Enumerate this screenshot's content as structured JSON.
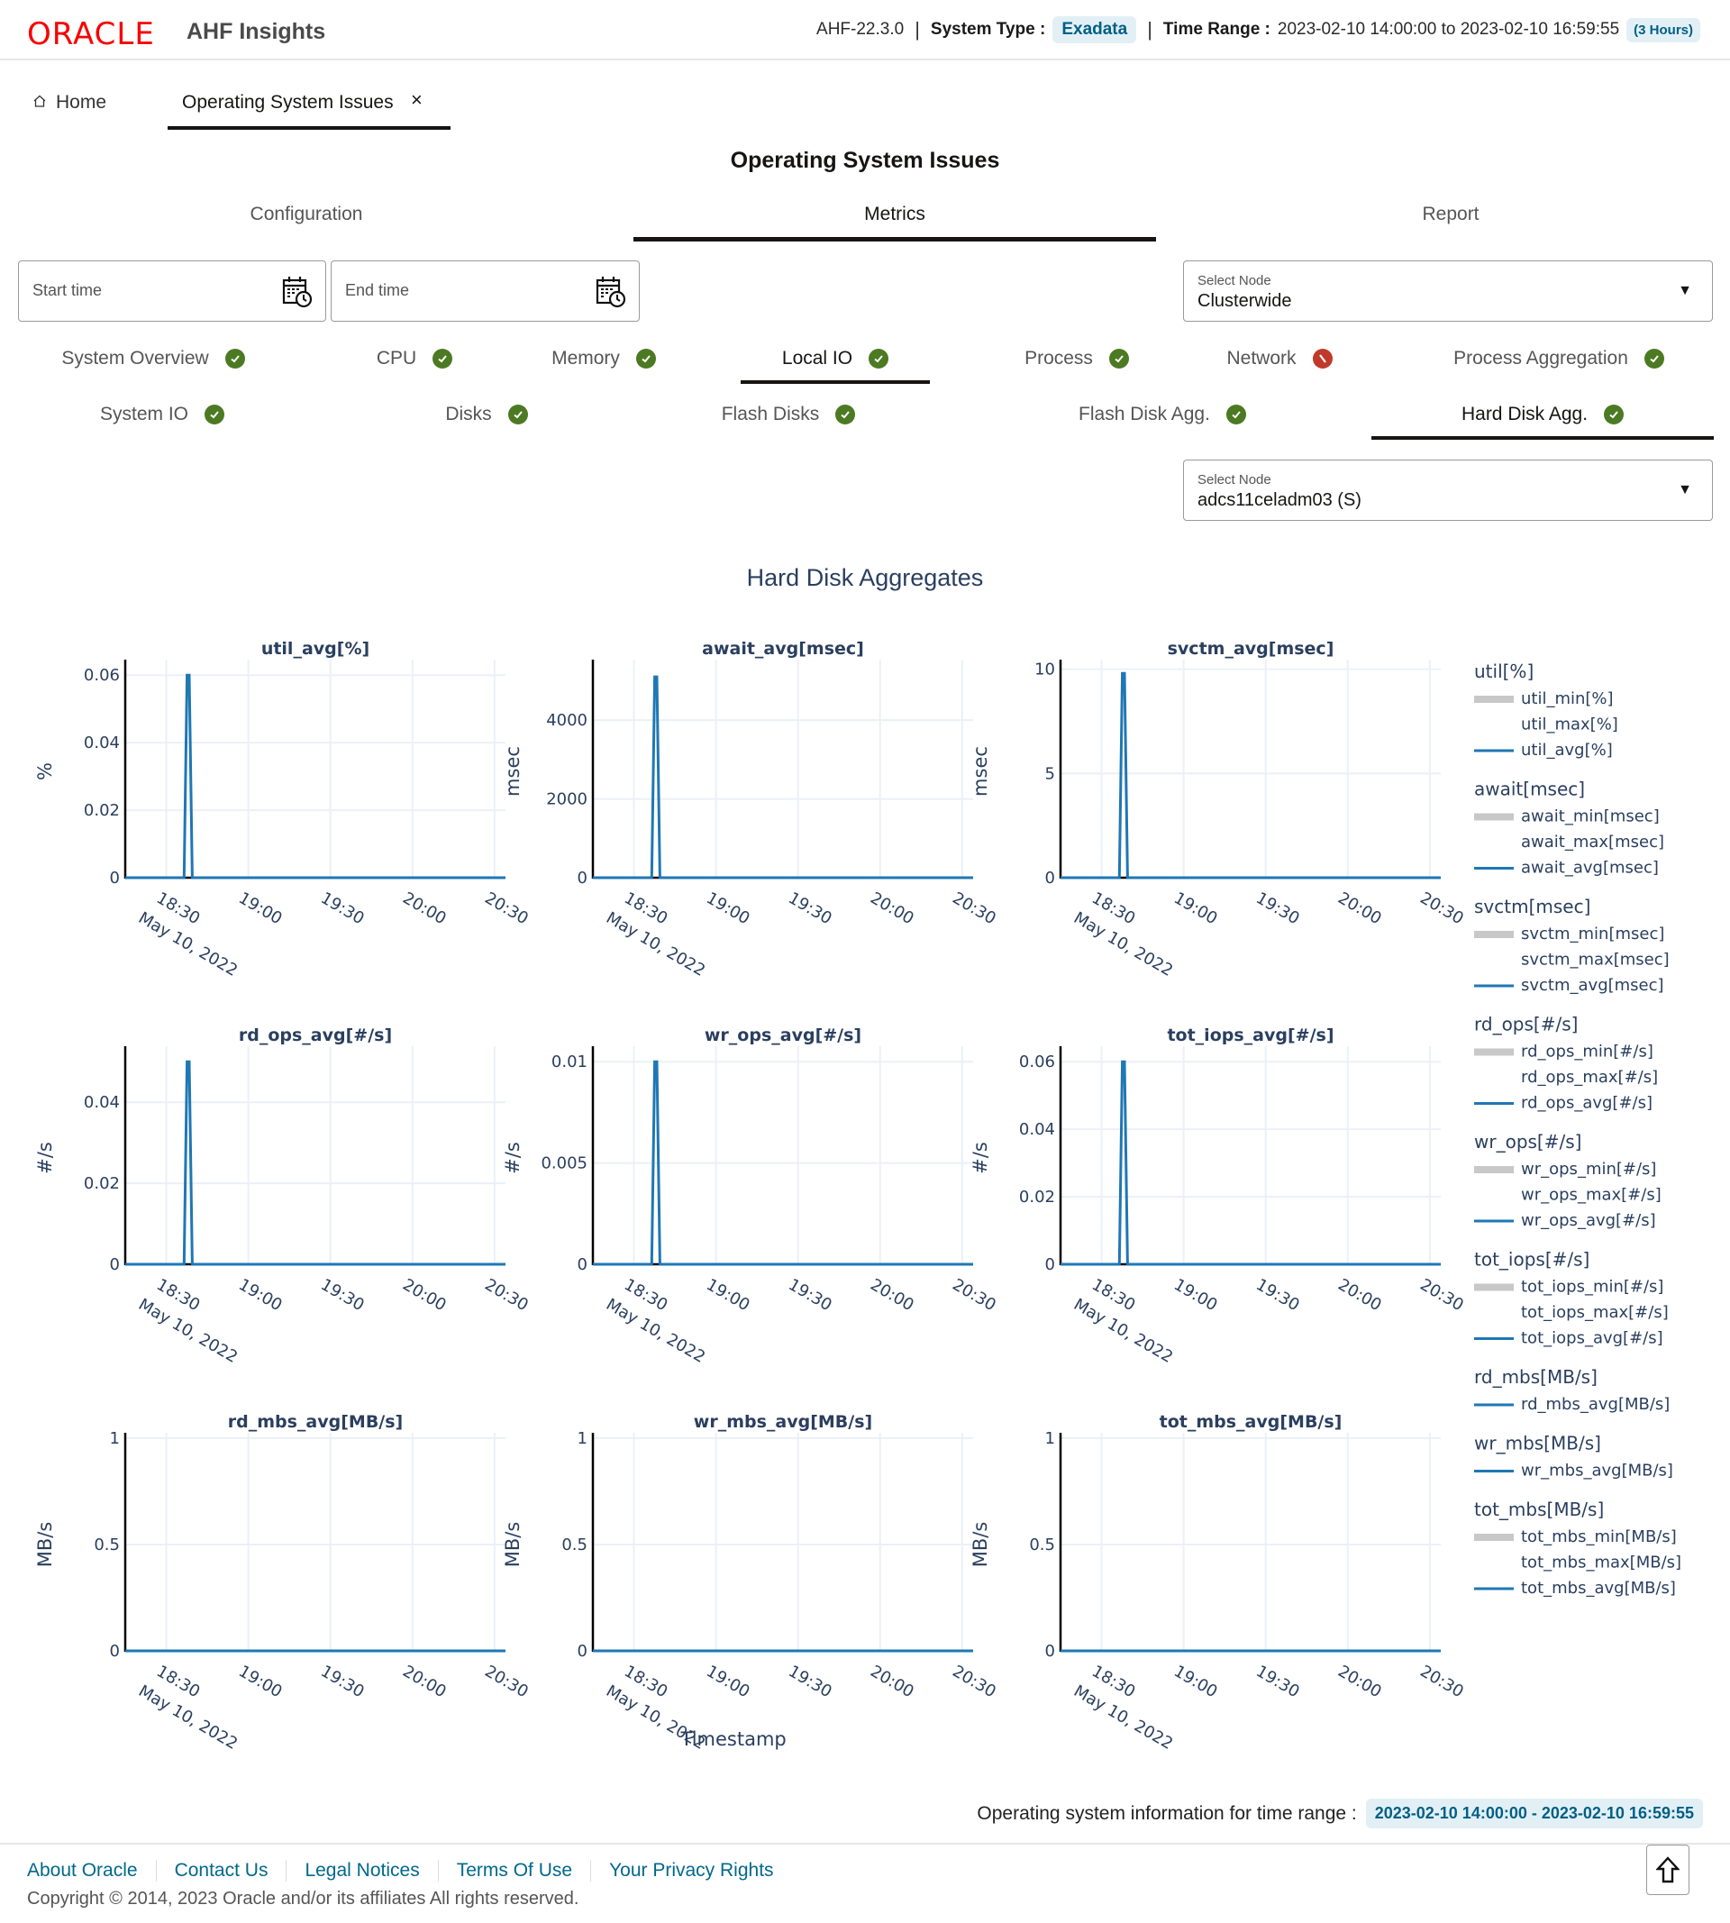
{
  "header": {
    "brand": "ORACLE",
    "app_name": "AHF Insights",
    "version": "AHF-22.3.0",
    "system_type_label": "System Type :",
    "system_type": "Exadata",
    "time_range_label": "Time Range :",
    "time_range": "2023-02-10 14:00:00 to 2023-02-10 16:59:55",
    "time_range_duration": "(3 Hours)"
  },
  "breadcrumbs": {
    "home": "Home",
    "active": "Operating System Issues",
    "close": "×"
  },
  "page_title": "Operating System Issues",
  "main_tabs": [
    {
      "label": "Configuration",
      "active": false
    },
    {
      "label": "Metrics",
      "active": true
    },
    {
      "label": "Report",
      "active": false
    }
  ],
  "filters": {
    "start_time_placeholder": "Start time",
    "end_time_placeholder": "End time",
    "node_select_label": "Select Node",
    "node_select_value": "Clusterwide"
  },
  "sub_tabs_row1": [
    {
      "label": "System Overview",
      "status": "ok",
      "active": false
    },
    {
      "label": "CPU",
      "status": "ok",
      "active": false
    },
    {
      "label": "Memory",
      "status": "ok",
      "active": false
    },
    {
      "label": "Local IO",
      "status": "ok",
      "active": true
    },
    {
      "label": "Process",
      "status": "ok",
      "active": false
    },
    {
      "label": "Network",
      "status": "error",
      "active": false
    },
    {
      "label": "Process Aggregation",
      "status": "ok",
      "active": false
    }
  ],
  "sub_tabs_row2": [
    {
      "label": "System IO",
      "status": "ok",
      "active": false
    },
    {
      "label": "Disks",
      "status": "ok",
      "active": false
    },
    {
      "label": "Flash Disks",
      "status": "ok",
      "active": false
    },
    {
      "label": "Flash Disk Agg.",
      "status": "ok",
      "active": false
    },
    {
      "label": "Hard Disk Agg.",
      "status": "ok",
      "active": true
    }
  ],
  "node_select2": {
    "label": "Select Node",
    "value": "adcs11celadm03 (S)"
  },
  "section_title": "Hard Disk Aggregates",
  "colors": {
    "series": "#1f77b4",
    "min_band": "#c8c8c8",
    "ok": "#4c7a23",
    "error": "#c0392b",
    "brand": "#f80000",
    "accent": "#005f86"
  },
  "chart_data": {
    "type": "line",
    "x_ticks": [
      "18:30",
      "19:00",
      "19:30",
      "20:00",
      "20:30"
    ],
    "x_tick_sublabel": "May 10, 2022",
    "x_label": "Timestamp",
    "x_range_minutes": [
      1095,
      1234
    ],
    "spike_minute": 1118,
    "charts": [
      {
        "title": "util_avg[%]",
        "ylabel": "%",
        "ylim": [
          0,
          0.063
        ],
        "yticks": [
          0,
          0.02,
          0.04,
          0.06
        ],
        "ytick_labels": [
          "0",
          "0.02",
          "0.04",
          "0.06"
        ],
        "peak": 0.06
      },
      {
        "title": "await_avg[msec]",
        "ylabel": "msec",
        "ylim": [
          0,
          5400
        ],
        "yticks": [
          0,
          2000,
          4000
        ],
        "ytick_labels": [
          "0",
          "2000",
          "4000"
        ],
        "peak": 5100
      },
      {
        "title": "svctm_avg[msec]",
        "ylabel": "msec",
        "ylim": [
          0,
          10.2
        ],
        "yticks": [
          0,
          5,
          10
        ],
        "ytick_labels": [
          "0",
          "5",
          "10"
        ],
        "peak": 9.8
      },
      {
        "title": "rd_ops_avg[#/s]",
        "ylabel": "#/s",
        "ylim": [
          0,
          0.0525
        ],
        "yticks": [
          0,
          0.02,
          0.04
        ],
        "ytick_labels": [
          "0",
          "0.02",
          "0.04"
        ],
        "peak": 0.05
      },
      {
        "title": "wr_ops_avg[#/s]",
        "ylabel": "#/s",
        "ylim": [
          0,
          0.0105
        ],
        "yticks": [
          0,
          0.005,
          0.01
        ],
        "ytick_labels": [
          "0",
          "0.005",
          "0.01"
        ],
        "peak": 0.01
      },
      {
        "title": "tot_iops_avg[#/s]",
        "ylabel": "#/s",
        "ylim": [
          0,
          0.063
        ],
        "yticks": [
          0,
          0.02,
          0.04,
          0.06
        ],
        "ytick_labels": [
          "0",
          "0.02",
          "0.04",
          "0.06"
        ],
        "peak": 0.06
      },
      {
        "title": "rd_mbs_avg[MB/s]",
        "ylabel": "MB/s",
        "ylim": [
          0,
          1
        ],
        "yticks": [
          0,
          0.5,
          1
        ],
        "ytick_labels": [
          "0",
          "0.5",
          "1"
        ],
        "peak": 0
      },
      {
        "title": "wr_mbs_avg[MB/s]",
        "ylabel": "MB/s",
        "ylim": [
          0,
          1
        ],
        "yticks": [
          0,
          0.5,
          1
        ],
        "ytick_labels": [
          "0",
          "0.5",
          "1"
        ],
        "peak": 0
      },
      {
        "title": "tot_mbs_avg[MB/s]",
        "ylabel": "MB/s",
        "ylim": [
          0,
          1
        ],
        "yticks": [
          0,
          0.5,
          1
        ],
        "ytick_labels": [
          "0",
          "0.5",
          "1"
        ],
        "peak": 0
      }
    ],
    "legend": [
      {
        "group": "util[%]",
        "items": [
          {
            "name": "util_min[%]",
            "style": "band"
          },
          {
            "name": "util_max[%]",
            "style": "none"
          },
          {
            "name": "util_avg[%]",
            "style": "line"
          }
        ]
      },
      {
        "group": "await[msec]",
        "items": [
          {
            "name": "await_min[msec]",
            "style": "band"
          },
          {
            "name": "await_max[msec]",
            "style": "none"
          },
          {
            "name": "await_avg[msec]",
            "style": "line"
          }
        ]
      },
      {
        "group": "svctm[msec]",
        "items": [
          {
            "name": "svctm_min[msec]",
            "style": "band"
          },
          {
            "name": "svctm_max[msec]",
            "style": "none"
          },
          {
            "name": "svctm_avg[msec]",
            "style": "line"
          }
        ]
      },
      {
        "group": "rd_ops[#/s]",
        "items": [
          {
            "name": "rd_ops_min[#/s]",
            "style": "band"
          },
          {
            "name": "rd_ops_max[#/s]",
            "style": "none"
          },
          {
            "name": "rd_ops_avg[#/s]",
            "style": "line"
          }
        ]
      },
      {
        "group": "wr_ops[#/s]",
        "items": [
          {
            "name": "wr_ops_min[#/s]",
            "style": "band"
          },
          {
            "name": "wr_ops_max[#/s]",
            "style": "none"
          },
          {
            "name": "wr_ops_avg[#/s]",
            "style": "line"
          }
        ]
      },
      {
        "group": "tot_iops[#/s]",
        "items": [
          {
            "name": "tot_iops_min[#/s]",
            "style": "band"
          },
          {
            "name": "tot_iops_max[#/s]",
            "style": "none"
          },
          {
            "name": "tot_iops_avg[#/s]",
            "style": "line"
          }
        ]
      },
      {
        "group": "rd_mbs[MB/s]",
        "items": [
          {
            "name": "rd_mbs_avg[MB/s]",
            "style": "line"
          }
        ]
      },
      {
        "group": "wr_mbs[MB/s]",
        "items": [
          {
            "name": "wr_mbs_avg[MB/s]",
            "style": "line"
          }
        ]
      },
      {
        "group": "tot_mbs[MB/s]",
        "items": [
          {
            "name": "tot_mbs_min[MB/s]",
            "style": "band"
          },
          {
            "name": "tot_mbs_max[MB/s]",
            "style": "none"
          },
          {
            "name": "tot_mbs_avg[MB/s]",
            "style": "line"
          }
        ]
      }
    ],
    "legend_position": "right",
    "grid": true
  },
  "range_info": {
    "label": "Operating system information for time range :",
    "value": "2023-02-10 14:00:00 - 2023-02-10 16:59:55"
  },
  "footer": {
    "links": [
      "About Oracle",
      "Contact Us",
      "Legal Notices",
      "Terms Of Use",
      "Your Privacy Rights"
    ],
    "copyright": "Copyright © 2014, 2023 Oracle and/or its affiliates All rights reserved."
  }
}
